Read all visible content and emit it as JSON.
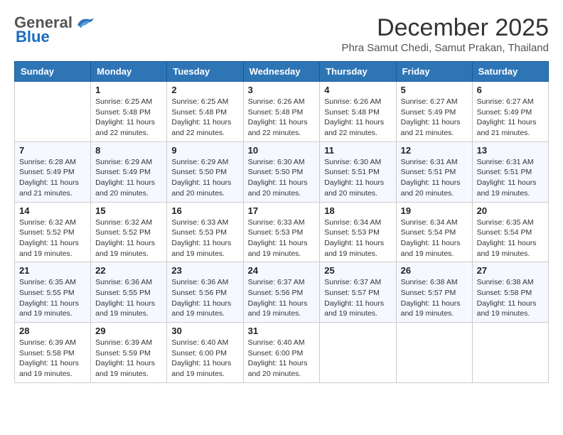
{
  "header": {
    "logo_general": "General",
    "logo_blue": "Blue",
    "month_title": "December 2025",
    "location": "Phra Samut Chedi, Samut Prakan, Thailand"
  },
  "days_of_week": [
    "Sunday",
    "Monday",
    "Tuesday",
    "Wednesday",
    "Thursday",
    "Friday",
    "Saturday"
  ],
  "weeks": [
    [
      {
        "day": "",
        "info": ""
      },
      {
        "day": "1",
        "info": "Sunrise: 6:25 AM\nSunset: 5:48 PM\nDaylight: 11 hours\nand 22 minutes."
      },
      {
        "day": "2",
        "info": "Sunrise: 6:25 AM\nSunset: 5:48 PM\nDaylight: 11 hours\nand 22 minutes."
      },
      {
        "day": "3",
        "info": "Sunrise: 6:26 AM\nSunset: 5:48 PM\nDaylight: 11 hours\nand 22 minutes."
      },
      {
        "day": "4",
        "info": "Sunrise: 6:26 AM\nSunset: 5:48 PM\nDaylight: 11 hours\nand 22 minutes."
      },
      {
        "day": "5",
        "info": "Sunrise: 6:27 AM\nSunset: 5:49 PM\nDaylight: 11 hours\nand 21 minutes."
      },
      {
        "day": "6",
        "info": "Sunrise: 6:27 AM\nSunset: 5:49 PM\nDaylight: 11 hours\nand 21 minutes."
      }
    ],
    [
      {
        "day": "7",
        "info": "Sunrise: 6:28 AM\nSunset: 5:49 PM\nDaylight: 11 hours\nand 21 minutes."
      },
      {
        "day": "8",
        "info": "Sunrise: 6:29 AM\nSunset: 5:49 PM\nDaylight: 11 hours\nand 20 minutes."
      },
      {
        "day": "9",
        "info": "Sunrise: 6:29 AM\nSunset: 5:50 PM\nDaylight: 11 hours\nand 20 minutes."
      },
      {
        "day": "10",
        "info": "Sunrise: 6:30 AM\nSunset: 5:50 PM\nDaylight: 11 hours\nand 20 minutes."
      },
      {
        "day": "11",
        "info": "Sunrise: 6:30 AM\nSunset: 5:51 PM\nDaylight: 11 hours\nand 20 minutes."
      },
      {
        "day": "12",
        "info": "Sunrise: 6:31 AM\nSunset: 5:51 PM\nDaylight: 11 hours\nand 20 minutes."
      },
      {
        "day": "13",
        "info": "Sunrise: 6:31 AM\nSunset: 5:51 PM\nDaylight: 11 hours\nand 19 minutes."
      }
    ],
    [
      {
        "day": "14",
        "info": "Sunrise: 6:32 AM\nSunset: 5:52 PM\nDaylight: 11 hours\nand 19 minutes."
      },
      {
        "day": "15",
        "info": "Sunrise: 6:32 AM\nSunset: 5:52 PM\nDaylight: 11 hours\nand 19 minutes."
      },
      {
        "day": "16",
        "info": "Sunrise: 6:33 AM\nSunset: 5:53 PM\nDaylight: 11 hours\nand 19 minutes."
      },
      {
        "day": "17",
        "info": "Sunrise: 6:33 AM\nSunset: 5:53 PM\nDaylight: 11 hours\nand 19 minutes."
      },
      {
        "day": "18",
        "info": "Sunrise: 6:34 AM\nSunset: 5:53 PM\nDaylight: 11 hours\nand 19 minutes."
      },
      {
        "day": "19",
        "info": "Sunrise: 6:34 AM\nSunset: 5:54 PM\nDaylight: 11 hours\nand 19 minutes."
      },
      {
        "day": "20",
        "info": "Sunrise: 6:35 AM\nSunset: 5:54 PM\nDaylight: 11 hours\nand 19 minutes."
      }
    ],
    [
      {
        "day": "21",
        "info": "Sunrise: 6:35 AM\nSunset: 5:55 PM\nDaylight: 11 hours\nand 19 minutes."
      },
      {
        "day": "22",
        "info": "Sunrise: 6:36 AM\nSunset: 5:55 PM\nDaylight: 11 hours\nand 19 minutes."
      },
      {
        "day": "23",
        "info": "Sunrise: 6:36 AM\nSunset: 5:56 PM\nDaylight: 11 hours\nand 19 minutes."
      },
      {
        "day": "24",
        "info": "Sunrise: 6:37 AM\nSunset: 5:56 PM\nDaylight: 11 hours\nand 19 minutes."
      },
      {
        "day": "25",
        "info": "Sunrise: 6:37 AM\nSunset: 5:57 PM\nDaylight: 11 hours\nand 19 minutes."
      },
      {
        "day": "26",
        "info": "Sunrise: 6:38 AM\nSunset: 5:57 PM\nDaylight: 11 hours\nand 19 minutes."
      },
      {
        "day": "27",
        "info": "Sunrise: 6:38 AM\nSunset: 5:58 PM\nDaylight: 11 hours\nand 19 minutes."
      }
    ],
    [
      {
        "day": "28",
        "info": "Sunrise: 6:39 AM\nSunset: 5:58 PM\nDaylight: 11 hours\nand 19 minutes."
      },
      {
        "day": "29",
        "info": "Sunrise: 6:39 AM\nSunset: 5:59 PM\nDaylight: 11 hours\nand 19 minutes."
      },
      {
        "day": "30",
        "info": "Sunrise: 6:40 AM\nSunset: 6:00 PM\nDaylight: 11 hours\nand 19 minutes."
      },
      {
        "day": "31",
        "info": "Sunrise: 6:40 AM\nSunset: 6:00 PM\nDaylight: 11 hours\nand 20 minutes."
      },
      {
        "day": "",
        "info": ""
      },
      {
        "day": "",
        "info": ""
      },
      {
        "day": "",
        "info": ""
      }
    ]
  ]
}
